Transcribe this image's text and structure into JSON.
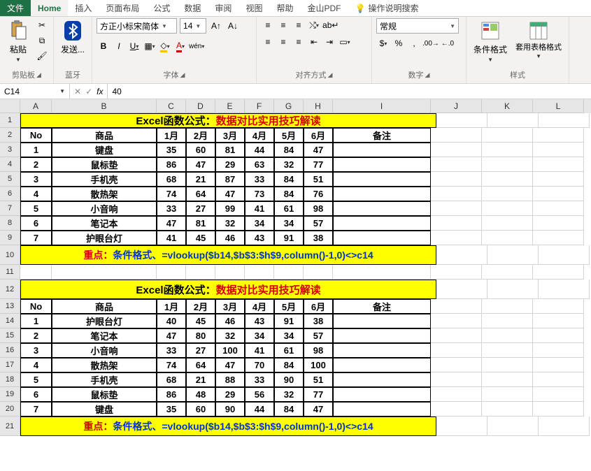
{
  "tabs": {
    "file": "文件",
    "home": "Home",
    "insert": "插入",
    "layout": "页面布局",
    "formulas": "公式",
    "data": "数据",
    "review": "审阅",
    "view": "视图",
    "help": "帮助",
    "pdf": "金山PDF",
    "tell_me": "操作说明搜索"
  },
  "ribbon": {
    "clipboard": {
      "paste": "粘贴",
      "label": "剪贴板"
    },
    "bluetooth": {
      "send": "发送...",
      "label": "蓝牙"
    },
    "font": {
      "name": "方正小标宋简体",
      "size": "14",
      "label": "字体"
    },
    "align": {
      "label": "对齐方式"
    },
    "number": {
      "format": "常规",
      "label": "数字"
    },
    "styles": {
      "cond": "条件格式",
      "table": "套用表格格式",
      "label": "样式"
    }
  },
  "formulabar": {
    "namebox": "C14",
    "value": "40",
    "fx": "fx"
  },
  "cols": [
    "A",
    "B",
    "C",
    "D",
    "E",
    "F",
    "G",
    "H",
    "I",
    "J",
    "K",
    "L"
  ],
  "title": {
    "black": "Excel函数公式：",
    "red": "数据对比实用技巧解读"
  },
  "headers": {
    "no": "No",
    "item": "商品",
    "m1": "1月",
    "m2": "2月",
    "m3": "3月",
    "m4": "4月",
    "m5": "5月",
    "m6": "6月",
    "note": "备注"
  },
  "table1": [
    {
      "no": "1",
      "item": "键盘",
      "v": [
        35,
        60,
        81,
        44,
        84,
        47
      ]
    },
    {
      "no": "2",
      "item": "鼠标垫",
      "v": [
        86,
        47,
        29,
        63,
        32,
        77
      ]
    },
    {
      "no": "3",
      "item": "手机壳",
      "v": [
        68,
        21,
        87,
        33,
        84,
        51
      ]
    },
    {
      "no": "4",
      "item": "散热架",
      "v": [
        74,
        64,
        47,
        73,
        84,
        76
      ]
    },
    {
      "no": "5",
      "item": "小音响",
      "v": [
        33,
        27,
        99,
        41,
        61,
        98
      ]
    },
    {
      "no": "6",
      "item": "笔记本",
      "v": [
        47,
        81,
        32,
        34,
        34,
        57
      ]
    },
    {
      "no": "7",
      "item": "护眼台灯",
      "v": [
        41,
        45,
        46,
        43,
        91,
        38
      ]
    }
  ],
  "formula": {
    "red": "重点：",
    "blue": "条件格式、=vlookup($b14,$b$3:$h$9,column()-1,0)<>c14"
  },
  "table2": [
    {
      "no": "1",
      "item": "护眼台灯",
      "v": [
        40,
        45,
        46,
        43,
        91,
        38
      ]
    },
    {
      "no": "2",
      "item": "笔记本",
      "v": [
        47,
        80,
        32,
        34,
        34,
        57
      ]
    },
    {
      "no": "3",
      "item": "小音响",
      "v": [
        33,
        27,
        100,
        41,
        61,
        98
      ]
    },
    {
      "no": "4",
      "item": "散热架",
      "v": [
        74,
        64,
        47,
        70,
        84,
        100
      ]
    },
    {
      "no": "5",
      "item": "手机壳",
      "v": [
        68,
        21,
        88,
        33,
        90,
        51
      ]
    },
    {
      "no": "6",
      "item": "鼠标垫",
      "v": [
        86,
        48,
        29,
        56,
        32,
        77
      ]
    },
    {
      "no": "7",
      "item": "键盘",
      "v": [
        35,
        60,
        90,
        44,
        84,
        47
      ]
    }
  ]
}
